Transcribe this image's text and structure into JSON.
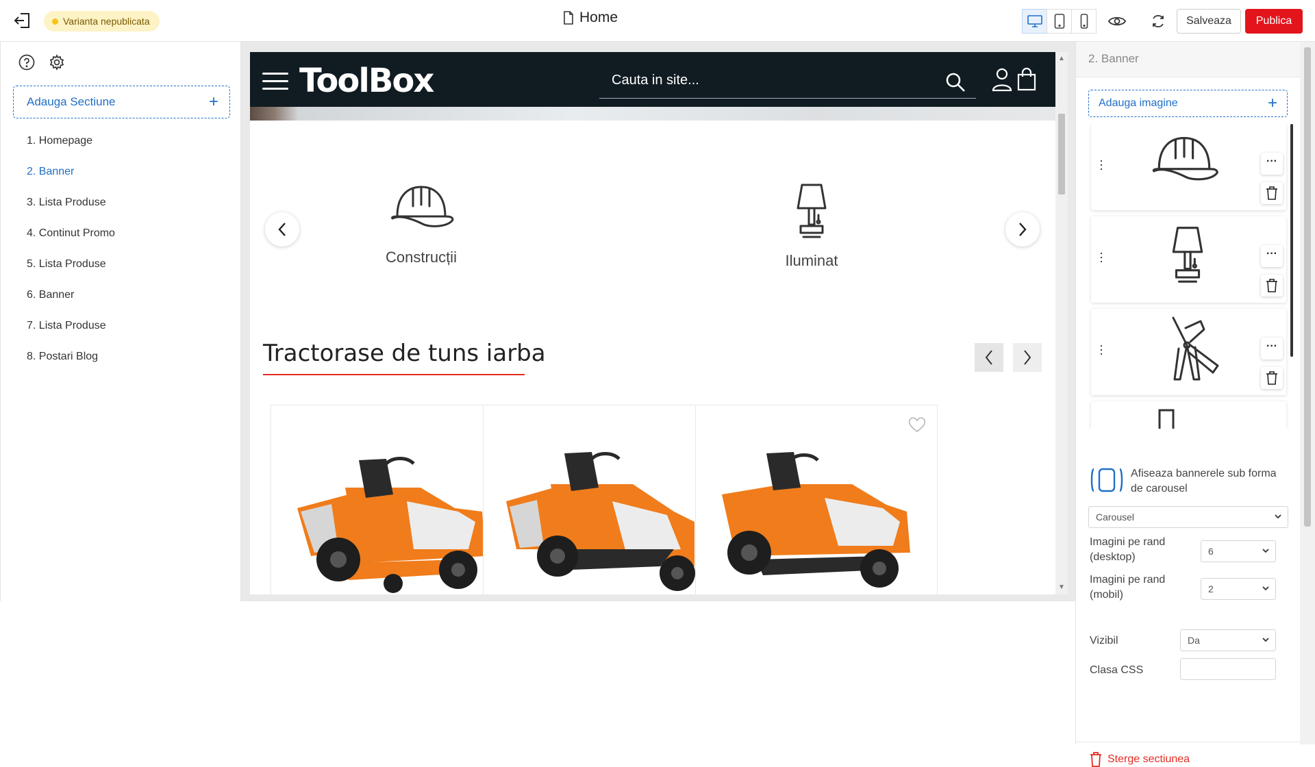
{
  "topbar": {
    "status_badge": "Varianta nepublicata",
    "page_title": "Home",
    "save_label": "Salveaza",
    "publish_label": "Publica"
  },
  "leftbar": {
    "add_section_label": "Adauga Sectiune",
    "sections": [
      "1. Homepage",
      "2. Banner",
      "3. Lista Produse",
      "4. Continut Promo",
      "5. Lista Produse",
      "6. Banner",
      "7. Lista Produse",
      "8. Postari Blog"
    ],
    "active_section_index": 1
  },
  "preview": {
    "logo": "ToolBox",
    "search_placeholder": "Cauta in site...",
    "categories": [
      "Construcții",
      "Iluminat"
    ],
    "product_list_title": "Tractorase de tuns iarba"
  },
  "rightbar": {
    "section_title": "2. Banner",
    "add_image_label": "Adauga imagine",
    "carousel_text": "Afiseaza bannerele sub forma de carousel",
    "display_mode": "Carousel",
    "per_row_desktop_label": "Imagini pe rand (desktop)",
    "per_row_desktop_value": "6",
    "per_row_mobile_label": "Imagini pe rand (mobil)",
    "per_row_mobile_value": "2",
    "visible_label": "Vizibil",
    "visible_value": "Da",
    "css_class_label": "Clasa CSS",
    "css_class_value": "",
    "delete_label": "Sterge sectiunea"
  },
  "colors": {
    "accent_blue": "#1f6fc7",
    "publish_red": "#e3141b",
    "site_header": "#111c22",
    "mower_orange": "#f07c1b"
  }
}
